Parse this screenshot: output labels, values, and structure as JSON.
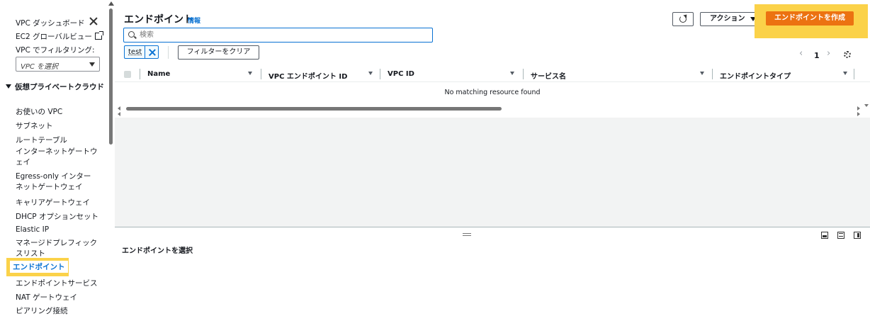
{
  "sidebar": {
    "dashboard": "VPC ダッシュボード",
    "ec2_global": "EC2 グローバルビュー",
    "filter_label": "VPC でフィルタリング:",
    "vpc_select_value": "VPC を選択",
    "section": "仮想プライベートクラウド",
    "items": [
      "お使いの VPC",
      "サブネット",
      "ルートテーブル",
      "インターネットゲートウェイ",
      "Egress-only インターネットゲートウェイ",
      "キャリアゲートウェイ",
      "DHCP オプションセット",
      "Elastic IP",
      "マネージドプレフィックスリスト",
      "エンドポイント",
      "エンドポイントサービス",
      "NAT ゲートウェイ",
      "ピアリング接続"
    ]
  },
  "main": {
    "title": "エンドポイント",
    "info": "情報",
    "actions_label": "アクション",
    "create_label": "エンドポイントを作成",
    "search_placeholder": "検索",
    "filter_token": "test",
    "clear_filter": "フィルターをクリア",
    "page": "1",
    "columns": [
      "Name",
      "VPC エンドポイント ID",
      "VPC ID",
      "サービス名",
      "エンドポイントタイプ"
    ],
    "empty_message": "No matching resource found",
    "select_prompt": "エンドポイントを選択"
  },
  "colors": {
    "accent": "#0972d3",
    "primary_button": "#ec7211",
    "highlight": "#fbd249"
  }
}
